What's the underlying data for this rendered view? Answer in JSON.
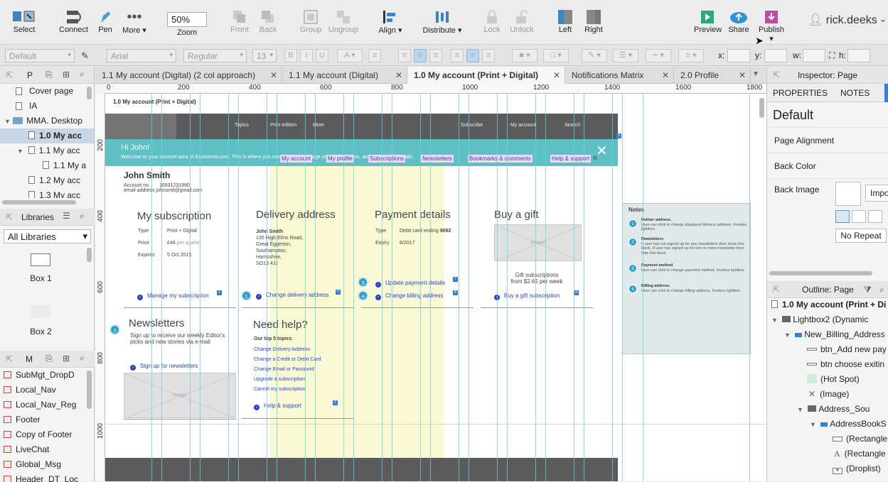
{
  "toolbar": {
    "select": "Select",
    "connect": "Connect",
    "pen": "Pen",
    "more": "More ▾",
    "zoom_value": "50%",
    "zoom": "Zoom",
    "front": "Front",
    "back": "Back",
    "group": "Group",
    "ungroup": "Ungroup",
    "align": "Align ▾",
    "distribute": "Distribute ▾",
    "lock": "Lock",
    "unlock": "Unlock",
    "left": "Left",
    "right": "Right",
    "preview": "Preview",
    "share": "Share",
    "publish": "Publish ▾",
    "user": "rick.deeks"
  },
  "format": {
    "style": "Default",
    "font": "Arial",
    "weight": "Regular",
    "size": "13",
    "x": "x:",
    "y": "y:",
    "w": "w:",
    "h": "h:"
  },
  "pages": {
    "header": "P",
    "items": [
      {
        "label": "Cover page"
      },
      {
        "label": "IA"
      },
      {
        "label": "MMA. Desktop"
      },
      {
        "label": "1.0 My acc"
      },
      {
        "label": "1.1 My acc"
      },
      {
        "label": "1.1 My a"
      },
      {
        "label": "1.2 My acc"
      },
      {
        "label": "1.3 My acc"
      }
    ]
  },
  "libraries": {
    "header": "Libraries",
    "selected": "All Libraries",
    "items": [
      {
        "label": "Box 1"
      },
      {
        "label": "Box 2"
      }
    ]
  },
  "masters": {
    "header": "M",
    "items": [
      {
        "label": "SubMgt_DropD"
      },
      {
        "label": "Local_Nav"
      },
      {
        "label": "Local_Nav_Reg"
      },
      {
        "label": "Footer"
      },
      {
        "label": "Copy of Footer"
      },
      {
        "label": "LiveChat"
      },
      {
        "label": "Global_Msg"
      },
      {
        "label": "Header_DT_Loc"
      }
    ]
  },
  "tabs": [
    {
      "label": "1.1 My account (Digital) (2 col approach)"
    },
    {
      "label": "1.1 My account (Digital)"
    },
    {
      "label": "1.0 My account (Print + Digital)"
    },
    {
      "label": "Notifications Matrix"
    },
    {
      "label": "2.0 Profile"
    }
  ],
  "ruler": {
    "h": [
      "0",
      "200",
      "400",
      "600",
      "800",
      "1000",
      "1200",
      "1400",
      "1600",
      "1800"
    ],
    "v": [
      "200",
      "400",
      "600",
      "800",
      "1000"
    ]
  },
  "wire": {
    "page_label": "1.0 My account (Print + Digital)",
    "nav": [
      "Topics",
      "Print edition",
      "More",
      "Subscribe",
      "My account",
      "Search"
    ],
    "banner_title": "Hi John!",
    "banner_text": "Welcome to your account area of Economist.com. This is where you can view and manage your subscription, and your profile details.",
    "name": "John Smith",
    "account_no_label": "Account no.",
    "account_no": "10931231990",
    "email_label": "email address",
    "email": "johnsmit@gmail.com",
    "subnav": [
      "My account",
      "My profile",
      "Subscriptions",
      "Newsletters",
      "Bookmarks & comments",
      "Help & support"
    ],
    "subscription": {
      "title": "My subscription",
      "type_label": "Type",
      "type": "Print + Digital",
      "price_label": "Price",
      "price": "£46",
      "price_suffix": "per quarter",
      "expires_label": "Expires",
      "expires": "5 Oct 2015",
      "link": "Manage my subscription"
    },
    "delivery": {
      "title": "Delivery address",
      "lines": [
        "John Smith",
        "135 High Elms Road,",
        "Great Eggerton,",
        "Southampton,",
        "Hampshire,",
        "SO13 4JJ"
      ],
      "link": "Change delivery address"
    },
    "payment": {
      "title": "Payment details",
      "type_label": "Type",
      "type": "Debit card ending",
      "card": "9092",
      "expiry_label": "Expiry",
      "expiry": "8/2017",
      "link1": "Update payment details",
      "link2": "Change billing address"
    },
    "gift": {
      "title": "Buy a gift",
      "image": "Image",
      "text1": "Gift subscriptions",
      "text2": "from $2.65 per week",
      "link": "Buy a gift subscription"
    },
    "newsletters": {
      "title": "Newsletters",
      "text": "Sign up to receive our weekly Editor's picks and new stories via e-mail",
      "link": "Sign up for newsletters",
      "image": "Image"
    },
    "help": {
      "title": "Need help?",
      "subtitle": "Our top 5 topics",
      "topics": [
        "Change Delivery Address",
        "Change a Credit or Debit Card",
        "Change Email or Password",
        "Upgrade a subscription",
        "Cancel my subscription"
      ],
      "link": "Help & support"
    },
    "notes": {
      "title": "Notes",
      "items": [
        {
          "title": "Deliver address.",
          "text": "User can click to change displayed delivery address. Invokes lightbox"
        },
        {
          "title": "Newsletters",
          "text": "If user has not signed up for any newsletters then show this block, if user has signed up for one or more newsletter then hide this block"
        },
        {
          "title": "Payment method",
          "text": "User can click to change payment method. Invokes lightbox"
        },
        {
          "title": "Billing address.",
          "text": "User can click to change billing address. Invokes lightbox"
        }
      ]
    }
  },
  "inspector": {
    "header": "Inspector: Page",
    "tab_properties": "PROPERTIES",
    "tab_notes": "NOTES",
    "style": "Default",
    "page_alignment": "Page Alignment",
    "back_color": "Back Color",
    "back_image": "Back Image",
    "import": "Impo",
    "no_repeat": "No Repeat"
  },
  "outline": {
    "header": "Outline: Page",
    "items": [
      {
        "label": "1.0 My account (Print + Di"
      },
      {
        "label": "Lightbox2 (Dynamic"
      },
      {
        "label": "New_Billing_Address"
      },
      {
        "label": "btn_Add new pay"
      },
      {
        "label": "btn choose exitin"
      },
      {
        "label": "(Hot Spot)"
      },
      {
        "label": "(Image)"
      },
      {
        "label": "Address_Sou"
      },
      {
        "label": "AddressBookS"
      },
      {
        "label": "(Rectangle"
      },
      {
        "label": "(Rectangle"
      },
      {
        "label": "(Droplist)"
      }
    ]
  }
}
